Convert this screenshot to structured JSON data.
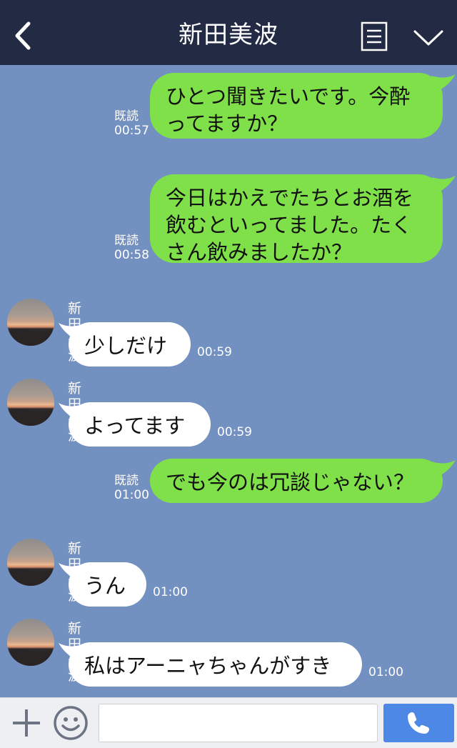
{
  "header": {
    "title": "新田美波",
    "back_icon": "chevron-left-icon",
    "menu_icon": "list-icon",
    "collapse_icon": "chevron-down-icon"
  },
  "messages": [
    {
      "direction": "sent",
      "text": "ひとつ聞きたいです。今酔\nってますか？",
      "read_label": "既読",
      "time": "00:57"
    },
    {
      "direction": "sent",
      "text": "今日はかえでたちとお酒を\n飲むといってました。たく\nさん飲みましたか？",
      "read_label": "既読",
      "time": "00:58"
    },
    {
      "direction": "received",
      "sender": "新田美波",
      "text": "少しだけ",
      "time": "00:59"
    },
    {
      "direction": "received",
      "sender": "新田美波",
      "text": "よってます",
      "time": "00:59"
    },
    {
      "direction": "sent",
      "text": "でも今のは冗談じゃない？",
      "read_label": "既読",
      "time": "01:00"
    },
    {
      "direction": "received",
      "sender": "新田美波",
      "text": "うん",
      "time": "01:00"
    },
    {
      "direction": "received",
      "sender": "新田美波",
      "text": "私はアーニャちゃんがすき",
      "time": "01:00"
    }
  ],
  "input_bar": {
    "plus_icon": "plus-icon",
    "emoji_icon": "smiley-icon",
    "input_value": "",
    "call_icon": "phone-icon"
  },
  "colors": {
    "header_bg": "#222b43",
    "chat_bg": "#7290c0",
    "sent_bubble": "#80e04a",
    "received_bubble": "#ffffff",
    "call_button": "#4d88e6"
  }
}
